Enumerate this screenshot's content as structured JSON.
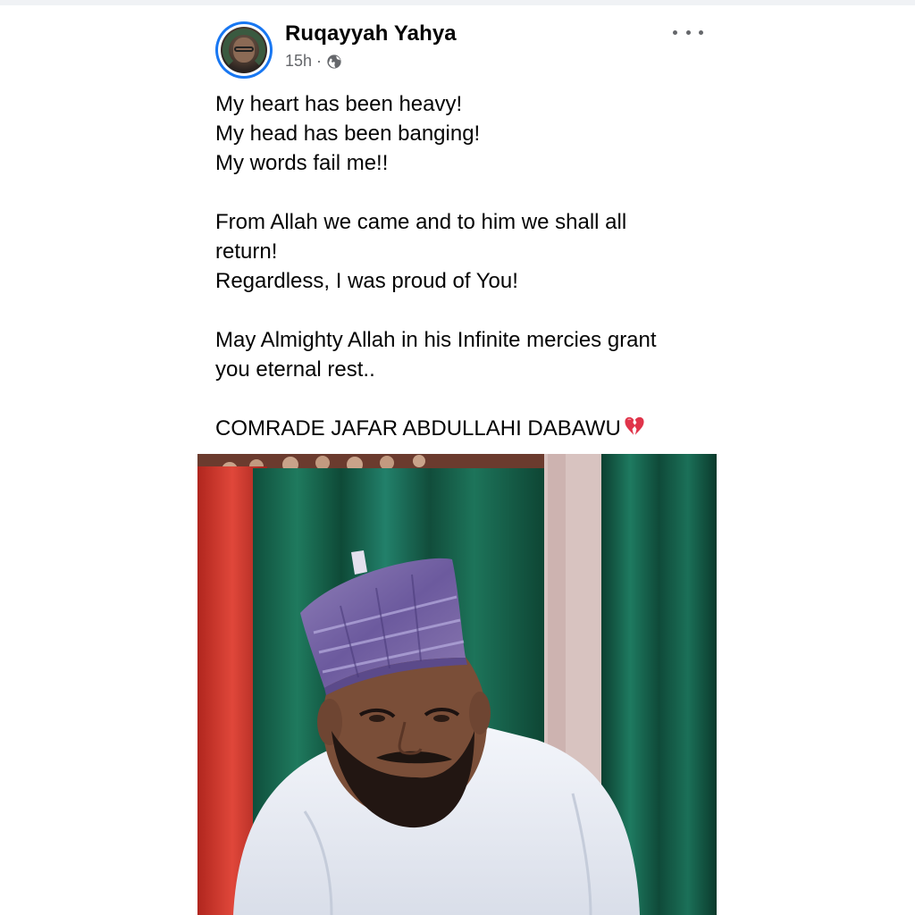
{
  "post": {
    "author": "Ruqayyah Yahya",
    "time": "15h",
    "separator": "·",
    "privacy_icon": "globe-icon",
    "more_icon": "more-options-icon",
    "lines": [
      "My heart has been heavy!",
      "My head has been banging!",
      "My words fail me!!",
      "",
      "From Allah we came and to him we shall all",
      "return!",
      "Regardless, I was proud of You!",
      "",
      "May Almighty Allah in his Infinite mercies grant",
      "you eternal rest..",
      "",
      "COMRADE JAFAR ABDULLAHI DABAWU"
    ],
    "closing_emoji": "broken-heart-icon"
  },
  "colors": {
    "accent": "#1877f2",
    "meta_text": "#65676b",
    "broken_heart": "#e0344a"
  }
}
